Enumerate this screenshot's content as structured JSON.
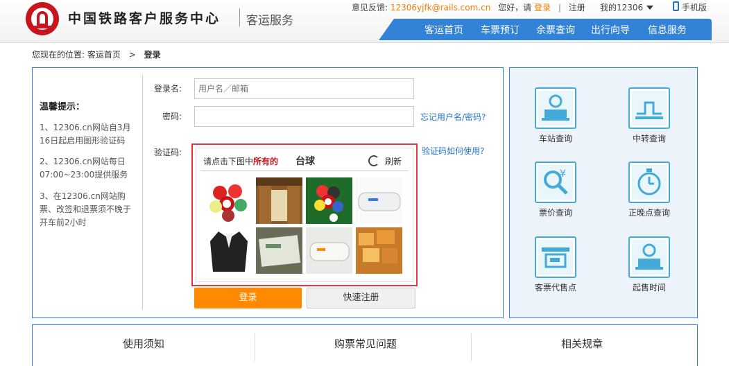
{
  "header": {
    "site_title": "中国铁路客户服务中心",
    "site_sub": "客运服务",
    "feedback_label": "意见反馈:",
    "feedback_email": "12306yjfk@rails.com.cn",
    "greeting": "您好，请",
    "login_link": "登录",
    "register_link": "注册",
    "my12306": "我的12306",
    "mobile": "手机版",
    "nav": [
      "客运首页",
      "车票预订",
      "余票查询",
      "出行向导",
      "信息服务"
    ]
  },
  "breadcrumb": {
    "prefix": "您现在的位置:",
    "home": "客运首页",
    "arrow": ">",
    "current": "登录"
  },
  "tips": {
    "title": "温馨提示：",
    "items": [
      "1、12306.cn网站自3月16日起启用图形验证码",
      "2、12306.cn网站每日07:00~23:00提供服务",
      "3、在12306.cn网站购票、改签和退票须不晚于开车前2小时"
    ]
  },
  "form": {
    "username_label": "登录名:",
    "username_placeholder": "用户名／邮箱",
    "password_label": "密码:",
    "forgot_link": "忘记用户名/密码?",
    "captcha_label": "验证码:",
    "captcha_help": "验证码如何使用?",
    "captcha_prompt_a": "请点击下图中",
    "captcha_prompt_b": "所有的",
    "captcha_word": "台球",
    "refresh": "刷新",
    "login_button": "登录",
    "register_button": "快速注册"
  },
  "quick_links": [
    "车站查询",
    "中转查询",
    "票价查询",
    "正晚点查询",
    "客票代售点",
    "起售时间"
  ],
  "bottom_tabs": [
    "使用须知",
    "购票常见问题",
    "相关规章"
  ],
  "colors": {
    "brand_red": "#c8141d",
    "nav_blue": "#3283d7",
    "accent_orange": "#ff8a00"
  }
}
